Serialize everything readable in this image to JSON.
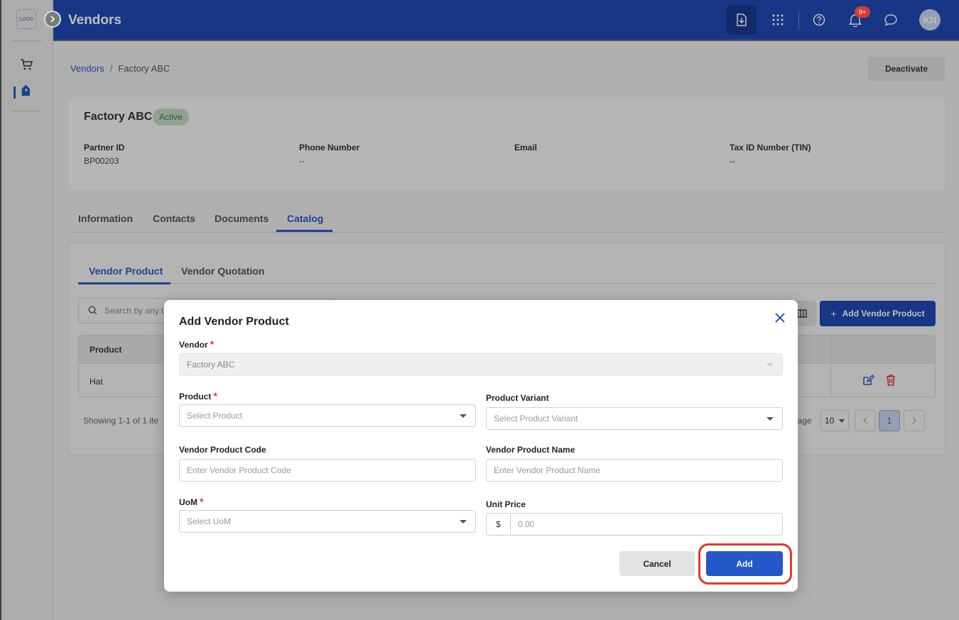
{
  "app": {
    "logo_text": "LOGO",
    "page_title": "Vendors"
  },
  "topbar": {
    "notifications_badge": "9+",
    "avatar_initials": "KN"
  },
  "breadcrumb": {
    "root": "Vendors",
    "separator": "/",
    "current": "Factory ABC"
  },
  "actions": {
    "deactivate_label": "Deactivate"
  },
  "vendor": {
    "name": "Factory ABC",
    "status": "Active",
    "fields": [
      {
        "label": "Partner ID",
        "value": "BP00203"
      },
      {
        "label": "Phone Number",
        "value": "--"
      },
      {
        "label": "Email",
        "value": ""
      },
      {
        "label": "Tax ID Number (TIN)",
        "value": "--"
      }
    ]
  },
  "tabs": [
    "Information",
    "Contacts",
    "Documents",
    "Catalog"
  ],
  "active_tab": "Catalog",
  "catalog": {
    "subtabs": [
      "Vendor Product",
      "Vendor Quotation"
    ],
    "search_placeholder": "Search by any t",
    "add_button_label": "Add Vendor Product",
    "table": {
      "headers": [
        "Product"
      ],
      "rows": [
        [
          "Hat"
        ]
      ]
    },
    "showing_text": "Showing 1-1 of 1 ite",
    "per_page_text": "page",
    "per_page_value": "10",
    "current_page": "1"
  },
  "modal": {
    "title": "Add Vendor Product",
    "fields": {
      "vendor": {
        "label": "Vendor",
        "value": "Factory ABC"
      },
      "product": {
        "label": "Product",
        "placeholder": "Select Product"
      },
      "product_variant": {
        "label": "Product Variant",
        "placeholder": "Select Product Variant"
      },
      "vendor_product_code": {
        "label": "Vendor Product Code",
        "placeholder": "Enter Vendor Product Code"
      },
      "vendor_product_name": {
        "label": "Vendor Product Name",
        "placeholder": "Enter Vendor Product Name"
      },
      "uom": {
        "label": "UoM",
        "placeholder": "Select UoM"
      },
      "unit_price": {
        "label": "Unit Price",
        "prefix": "$",
        "placeholder": "0.00"
      }
    },
    "required_mark": "*",
    "cancel_label": "Cancel",
    "add_label": "Add"
  },
  "colors": {
    "primary": "#1f48b2",
    "accent": "#2457c9",
    "highlight": "#e03a2a",
    "status_active_bg": "#bfd9c0"
  }
}
